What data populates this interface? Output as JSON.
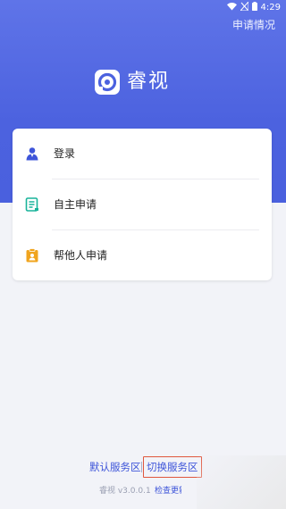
{
  "status_bar": {
    "time": "4:29"
  },
  "header": {
    "apply_status_link": "申请情况",
    "brand_name": "睿视",
    "accent_color": "#4c62df"
  },
  "menu": {
    "items": [
      {
        "label": "登录",
        "icon": "user-icon",
        "icon_color": "#3e55d9"
      },
      {
        "label": "自主申请",
        "icon": "document-icon",
        "icon_color": "#18b39a"
      },
      {
        "label": "帮他人申请",
        "icon": "clipboard-icon",
        "icon_color": "#f0a41e"
      }
    ]
  },
  "footer": {
    "default_region": "默认服务区",
    "switch_region": "切换服务区",
    "version": "睿视 v3.0.0.1",
    "check_update": "检查更新"
  }
}
